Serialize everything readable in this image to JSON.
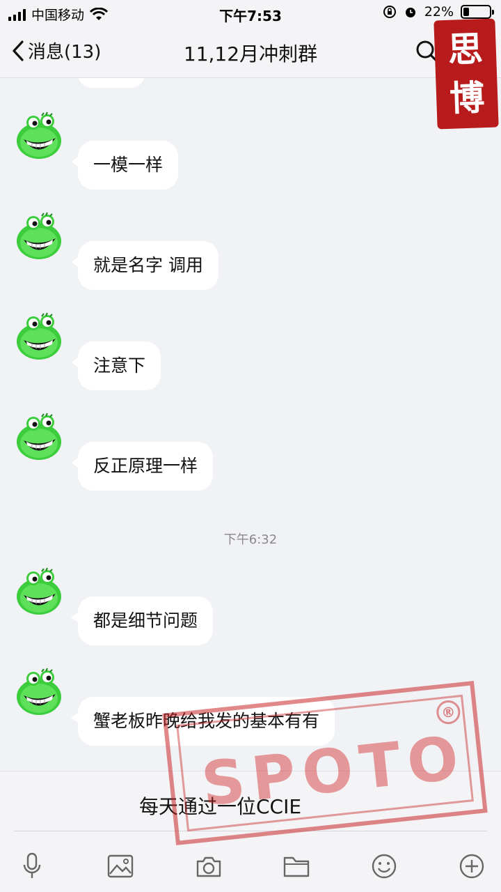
{
  "status_bar": {
    "carrier": "中国移动",
    "time": "下午7:53",
    "battery": "22%",
    "battery_level": 0.22
  },
  "nav": {
    "back_label": "消息(13)",
    "title": "11,12月冲刺群",
    "search_icon": "search-icon"
  },
  "messages": [
    {
      "text": "一模一样"
    },
    {
      "text": "就是名字  调用"
    },
    {
      "text": "注意下"
    },
    {
      "text": "反正原理一样"
    },
    {
      "text": "都是细节问题"
    },
    {
      "text": "蟹老板昨晚给我发的基本有有"
    }
  ],
  "timestamp": "下午6:32",
  "input": {
    "value": "每天通过一位CCIE"
  },
  "toolbar": [
    "mic-icon",
    "image-icon",
    "camera-icon",
    "folder-icon",
    "emoji-icon",
    "plus-icon"
  ],
  "watermarks": {
    "seal_text": [
      "思",
      "博"
    ],
    "stamp_text": "SPOTO",
    "stamp_mark": "®"
  },
  "colors": {
    "background": "#f1f2f5",
    "bubble": "#ffffff",
    "seal_red": "#b71b1b"
  }
}
